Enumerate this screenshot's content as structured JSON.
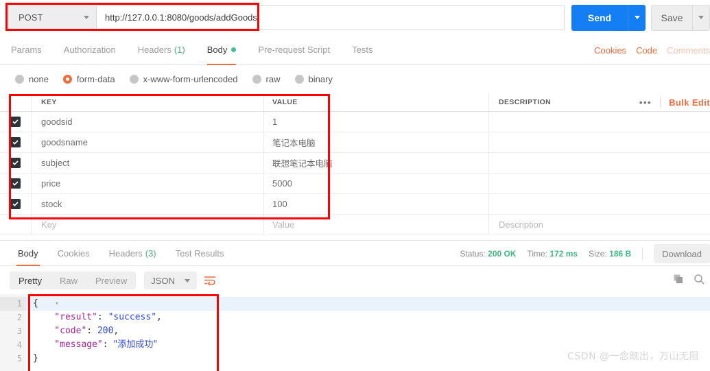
{
  "request": {
    "method": "POST",
    "url": "http://127.0.0.1:8080/goods/addGoods",
    "send_label": "Send",
    "save_label": "Save",
    "tabs": [
      {
        "label": "Params",
        "count": "",
        "active": false,
        "dot": false
      },
      {
        "label": "Authorization",
        "count": "",
        "active": false,
        "dot": false
      },
      {
        "label": "Headers",
        "count": "(1)",
        "active": false,
        "dot": false
      },
      {
        "label": "Body",
        "count": "",
        "active": true,
        "dot": true
      },
      {
        "label": "Pre-request Script",
        "count": "",
        "active": false,
        "dot": false
      },
      {
        "label": "Tests",
        "count": "",
        "active": false,
        "dot": false
      }
    ],
    "right_links": [
      {
        "label": "Cookies",
        "faded": false
      },
      {
        "label": "Code",
        "faded": false
      },
      {
        "label": "Comments",
        "faded": true
      }
    ],
    "body_types": [
      {
        "label": "none",
        "selected": false
      },
      {
        "label": "form-data",
        "selected": true
      },
      {
        "label": "x-www-form-urlencoded",
        "selected": false
      },
      {
        "label": "raw",
        "selected": false
      },
      {
        "label": "binary",
        "selected": false
      }
    ]
  },
  "table": {
    "headers": {
      "key": "KEY",
      "value": "VALUE",
      "description": "DESCRIPTION"
    },
    "bulk_edit_label": "Bulk Edit",
    "more_label": "•••",
    "rows": [
      {
        "checked": true,
        "key": "goodsid",
        "value": "1",
        "description": "",
        "cjk": false
      },
      {
        "checked": true,
        "key": "goodsname",
        "value": "笔记本电脑",
        "description": "",
        "cjk": true
      },
      {
        "checked": true,
        "key": "subject",
        "value": "联想笔记本电脑",
        "description": "",
        "cjk": true
      },
      {
        "checked": true,
        "key": "price",
        "value": "5000",
        "description": "",
        "cjk": false
      },
      {
        "checked": true,
        "key": "stock",
        "value": "100",
        "description": "",
        "cjk": false
      }
    ],
    "empty_row": {
      "key": "Key",
      "value": "Value",
      "description": "Description"
    }
  },
  "response": {
    "tabs": [
      {
        "label": "Body",
        "count": "",
        "active": true
      },
      {
        "label": "Cookies",
        "count": "",
        "active": false
      },
      {
        "label": "Headers",
        "count": "(3)",
        "active": false
      },
      {
        "label": "Test Results",
        "count": "",
        "active": false
      }
    ],
    "status_label": "Status:",
    "status_value": "200 OK",
    "time_label": "Time:",
    "time_value": "172 ms",
    "size_label": "Size:",
    "size_value": "186 B",
    "download_label": "Download",
    "view_modes": [
      {
        "label": "Pretty",
        "active": true
      },
      {
        "label": "Raw",
        "active": false
      },
      {
        "label": "Preview",
        "active": false
      }
    ],
    "format_selected": "JSON",
    "body": {
      "lines": [
        "1",
        "2",
        "3",
        "4",
        "5"
      ],
      "code": [
        {
          "indent": "",
          "parts": [
            {
              "t": "{",
              "c": "p"
            }
          ]
        },
        {
          "indent": "    ",
          "parts": [
            {
              "t": "\"result\"",
              "c": "k"
            },
            {
              "t": ": ",
              "c": "p"
            },
            {
              "t": "\"success\"",
              "c": "s"
            },
            {
              "t": ",",
              "c": "p"
            }
          ]
        },
        {
          "indent": "    ",
          "parts": [
            {
              "t": "\"code\"",
              "c": "k"
            },
            {
              "t": ": ",
              "c": "p"
            },
            {
              "t": "200",
              "c": "n"
            },
            {
              "t": ",",
              "c": "p"
            }
          ]
        },
        {
          "indent": "    ",
          "parts": [
            {
              "t": "\"message\"",
              "c": "k"
            },
            {
              "t": ": ",
              "c": "p"
            },
            {
              "t": "\"添加成功\"",
              "c": "cn-str"
            }
          ]
        },
        {
          "indent": "",
          "parts": [
            {
              "t": "}",
              "c": "p"
            }
          ]
        }
      ]
    }
  },
  "watermark": "CSDN @一念既出，万山无阻",
  "colors": {
    "accent_orange": "#f26b3a",
    "send_blue": "#147ef5",
    "status_green": "#3fb984",
    "annotation_red": "#ff0000"
  }
}
